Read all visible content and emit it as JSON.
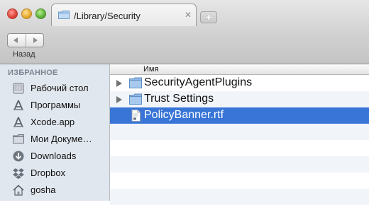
{
  "window": {
    "tab_title": "/Library/Security",
    "tab_close_glyph": "✕",
    "new_tab_glyph": "+"
  },
  "toolbar": {
    "back_label": "Назад"
  },
  "sidebar": {
    "header": "ИЗБРАННОЕ",
    "items": [
      {
        "label": "Рабочий стол",
        "icon": "desktop-icon"
      },
      {
        "label": "Программы",
        "icon": "applications-icon"
      },
      {
        "label": "Xcode.app",
        "icon": "applications-icon"
      },
      {
        "label": "Мои Докуме…",
        "icon": "folder-icon"
      },
      {
        "label": "Downloads",
        "icon": "downloads-icon"
      },
      {
        "label": "Dropbox",
        "icon": "dropbox-icon"
      },
      {
        "label": "gosha",
        "icon": "home-icon"
      }
    ]
  },
  "list": {
    "column_name": "Имя",
    "rows": [
      {
        "name": "SecurityAgentPlugins",
        "type": "folder",
        "selected": false
      },
      {
        "name": "Trust Settings",
        "type": "folder",
        "selected": false
      },
      {
        "name": "PolicyBanner.rtf",
        "type": "file",
        "selected": true
      }
    ]
  },
  "colors": {
    "selection": "#3875d7",
    "sidebar_bg": "#e1e7ee",
    "folder_blue": "#9fc3e8"
  }
}
